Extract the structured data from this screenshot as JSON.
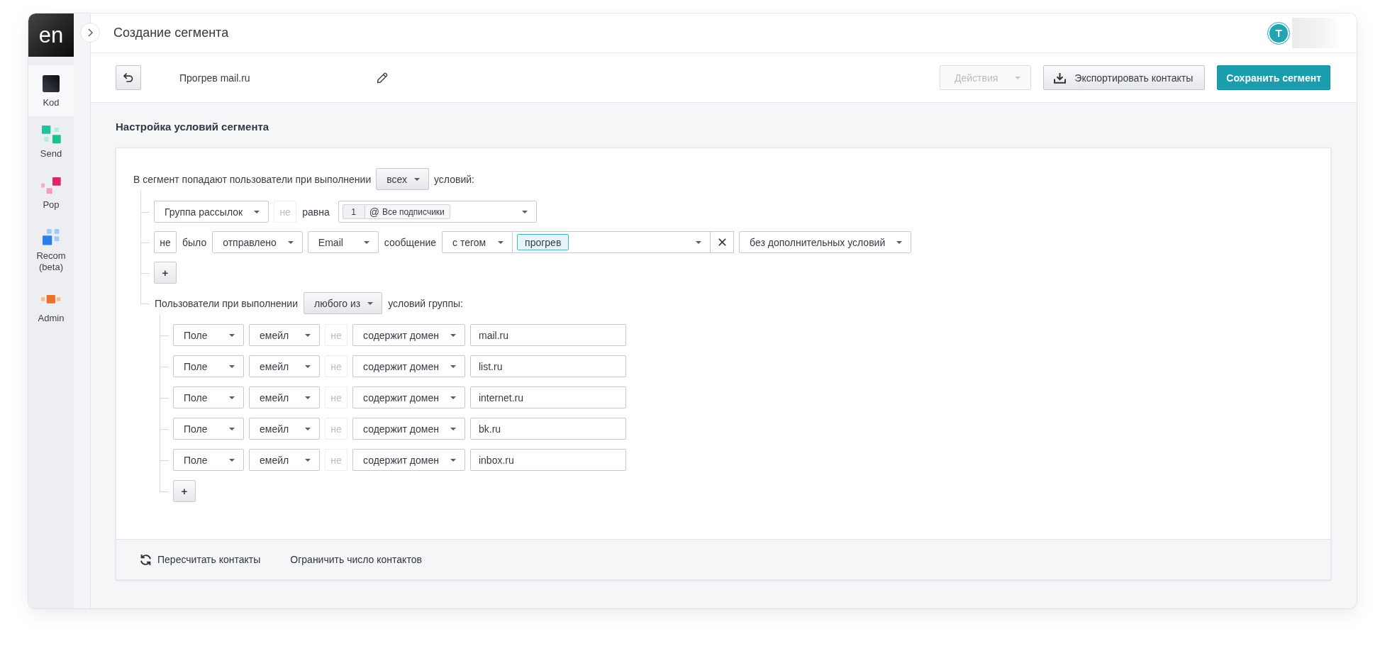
{
  "sidebar": {
    "logo": "en",
    "items": [
      {
        "label": "Kod",
        "selected": true
      },
      {
        "label": "Send",
        "selected": false
      },
      {
        "label": "Pop",
        "selected": false
      },
      {
        "label": "Recom (beta)",
        "selected": false
      },
      {
        "label": "Admin",
        "selected": false
      }
    ]
  },
  "header": {
    "title": "Создание сегмента",
    "avatar": "T"
  },
  "toolbar": {
    "segment_name": "Прогрев mail.ru",
    "buttons": [
      {
        "kind": "menu",
        "label": "Действия",
        "disabled": true
      },
      {
        "kind": "export",
        "label": "Экспортировать контакты",
        "disabled": false
      },
      {
        "kind": "primary",
        "label": "Сохранить сегмент",
        "disabled": false
      }
    ]
  },
  "settings": {
    "title": "Настройка условий сегмента",
    "intro": {
      "prefix": "В сегмент попадают пользователи при выполнении",
      "mode": "всех",
      "suffix": "условий:"
    },
    "conditions": [
      {
        "kind": "row",
        "parts": [
          {
            "kind": "select",
            "label": "Группа рассылок"
          },
          {
            "kind": "toggle",
            "label": "не",
            "on": false
          },
          {
            "kind": "text",
            "label": "равна"
          },
          {
            "kind": "multiselect",
            "count": "1",
            "chip_icon": "@",
            "chip": "Все подписчики"
          }
        ]
      },
      {
        "kind": "row",
        "parts": [
          {
            "kind": "toggle",
            "label": "не",
            "on": true
          },
          {
            "kind": "text",
            "label": "было"
          },
          {
            "kind": "select",
            "label": "отправлено"
          },
          {
            "kind": "select",
            "label": "Email"
          },
          {
            "kind": "text",
            "label": "сообщение"
          },
          {
            "kind": "tagfilter",
            "mode": "с тегом",
            "tags": [
              "прогрев"
            ]
          },
          {
            "kind": "select",
            "label": "без дополнительных условий"
          }
        ]
      },
      {
        "kind": "add",
        "label": "+"
      },
      {
        "kind": "group",
        "prefix": "Пользователи при выполнении",
        "mode": "любого из",
        "suffix": "условий группы:",
        "children": [
          {
            "kind": "row",
            "parts": [
              {
                "kind": "select",
                "label": "Поле"
              },
              {
                "kind": "select",
                "label": "емейл"
              },
              {
                "kind": "toggle",
                "label": "не",
                "on": false
              },
              {
                "kind": "select",
                "label": "содержит домен"
              },
              {
                "kind": "input",
                "value": "mail.ru"
              }
            ]
          },
          {
            "kind": "row",
            "parts": [
              {
                "kind": "select",
                "label": "Поле"
              },
              {
                "kind": "select",
                "label": "емейл"
              },
              {
                "kind": "toggle",
                "label": "не",
                "on": false
              },
              {
                "kind": "select",
                "label": "содержит домен"
              },
              {
                "kind": "input",
                "value": "list.ru"
              }
            ]
          },
          {
            "kind": "row",
            "parts": [
              {
                "kind": "select",
                "label": "Поле"
              },
              {
                "kind": "select",
                "label": "емейл"
              },
              {
                "kind": "toggle",
                "label": "не",
                "on": false
              },
              {
                "kind": "select",
                "label": "содержит домен"
              },
              {
                "kind": "input",
                "value": "internet.ru"
              }
            ]
          },
          {
            "kind": "row",
            "parts": [
              {
                "kind": "select",
                "label": "Поле"
              },
              {
                "kind": "select",
                "label": "емейл"
              },
              {
                "kind": "toggle",
                "label": "не",
                "on": false
              },
              {
                "kind": "select",
                "label": "содержит домен"
              },
              {
                "kind": "input",
                "value": "bk.ru"
              }
            ]
          },
          {
            "kind": "row",
            "parts": [
              {
                "kind": "select",
                "label": "Поле"
              },
              {
                "kind": "select",
                "label": "емейл"
              },
              {
                "kind": "toggle",
                "label": "не",
                "on": false
              },
              {
                "kind": "select",
                "label": "содержит домен"
              },
              {
                "kind": "input",
                "value": "inbox.ru"
              }
            ]
          },
          {
            "kind": "add",
            "label": "+"
          }
        ]
      }
    ]
  },
  "footer": {
    "actions": [
      {
        "kind": "refresh",
        "label": "Пересчитать контакты"
      },
      {
        "kind": "plain",
        "label": "Ограничить число контактов"
      }
    ]
  }
}
